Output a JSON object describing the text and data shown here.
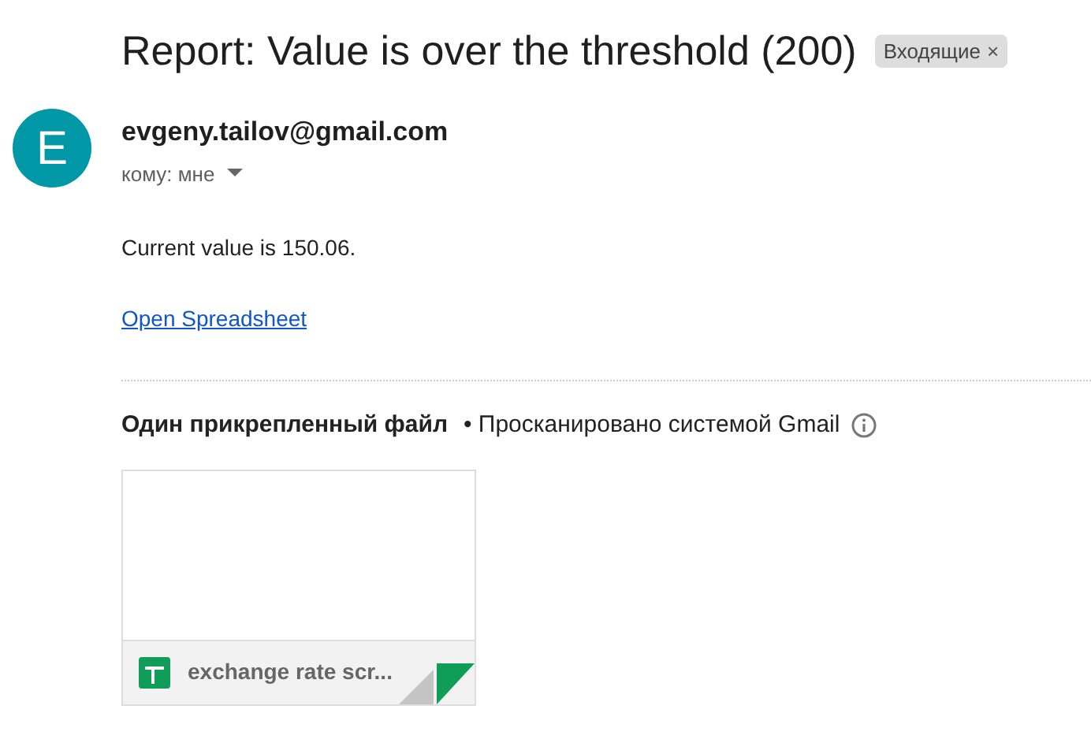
{
  "subject": "Report: Value is over the threshold (200)",
  "label": {
    "text": "Входящие",
    "close": "×"
  },
  "sender": {
    "avatar": "E",
    "email": "evgeny.tailov@gmail.com",
    "to": "кому: мне"
  },
  "body": {
    "text": "Current value is 150.06.",
    "link": "Open Spreadsheet"
  },
  "attachments": {
    "heading": "Один прикрепленный файл",
    "scanned": "• Просканировано системой Gmail",
    "files": [
      {
        "name": "exchange rate scr..."
      }
    ]
  }
}
